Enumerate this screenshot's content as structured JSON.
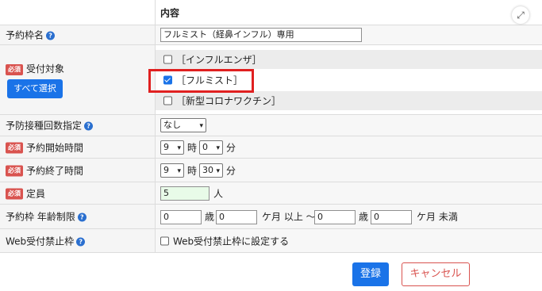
{
  "header": {
    "content_col": "内容"
  },
  "rows": {
    "name": {
      "label": "予約枠名",
      "value": "フルミスト（経鼻インフル）専用"
    },
    "target": {
      "required": "必須",
      "label": "受付対象",
      "select_all": "すべて選択",
      "options": [
        {
          "label": "［インフルエンザ］",
          "checked": false
        },
        {
          "label": "［フルミスト］",
          "checked": true
        },
        {
          "label": "［新型コロナワクチン］",
          "checked": false
        }
      ]
    },
    "dose": {
      "label": "予防接種回数指定",
      "value": "なし"
    },
    "start": {
      "required": "必須",
      "label": "予約開始時間",
      "hour": "9",
      "hour_unit": "時",
      "minute": "0",
      "minute_unit": "分"
    },
    "end": {
      "required": "必須",
      "label": "予約終了時間",
      "hour": "9",
      "hour_unit": "時",
      "minute": "30",
      "minute_unit": "分"
    },
    "capacity": {
      "required": "必須",
      "label": "定員",
      "value": "5",
      "unit": "人"
    },
    "age": {
      "label": "予約枠 年齢制限",
      "from_years": "0",
      "years_unit": "歳",
      "from_months": "0",
      "months_unit": "ケ月 以上 ～",
      "to_years": "0",
      "to_years_unit": "歳",
      "to_months": "0",
      "to_months_unit": "ケ月 未満"
    },
    "web": {
      "label": "Web受付禁止枠",
      "checkbox_label": "Web受付禁止枠に設定する"
    }
  },
  "buttons": {
    "register": "登録",
    "cancel": "キャンセル"
  },
  "icons": {
    "help": "?",
    "expand": "⤢"
  },
  "colors": {
    "primary": "#1a73e8",
    "required": "#d9534f",
    "highlight": "#e02020"
  }
}
